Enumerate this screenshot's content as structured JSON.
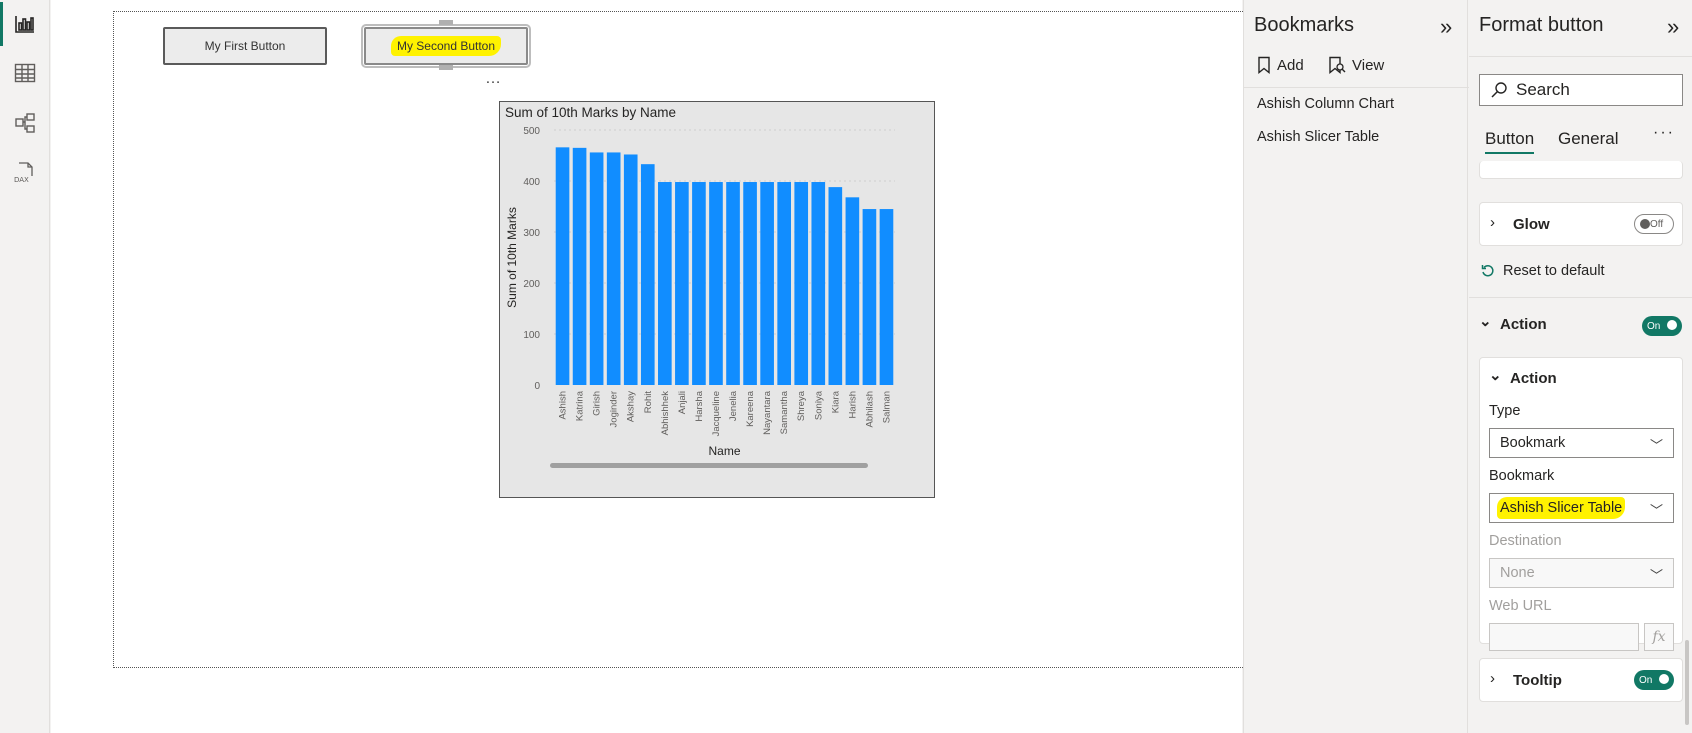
{
  "canvas": {
    "button1": "My First Button",
    "button2": "My Second Button",
    "more": "…",
    "chart_data": {
      "type": "bar",
      "title": "Sum of 10th Marks by Name",
      "xlabel": "Name",
      "ylabel": "Sum of 10th Marks",
      "ylim": [
        0,
        500
      ],
      "yticks": [
        0,
        100,
        200,
        300,
        400,
        500
      ],
      "color": "#118dff",
      "categories": [
        "Ashish",
        "Katrina",
        "Girish",
        "Joginder",
        "Akshay",
        "Rohit",
        "Abhishhek",
        "Anjali",
        "Harsha",
        "Jacqueline",
        "Jenelia",
        "Kareena",
        "Nayantara",
        "Samantha",
        "Shreya",
        "Soniya",
        "Kiara",
        "Harish",
        "Abhilash",
        "Salman"
      ],
      "values": [
        466,
        465,
        456,
        456,
        452,
        433,
        398,
        398,
        398,
        398,
        398,
        398,
        398,
        398,
        398,
        398,
        388,
        368,
        345,
        345
      ]
    }
  },
  "bookmarks": {
    "title": "Bookmarks",
    "add_label": "Add",
    "view_label": "View",
    "items": [
      "Ashish Column Chart",
      "Ashish Slicer Table"
    ]
  },
  "format": {
    "title": "Format button",
    "search_placeholder": "Search",
    "tabs": [
      "Button",
      "General"
    ],
    "more": "···",
    "glow_label": "Glow",
    "glow_toggle": "Off",
    "reset_label": "Reset to default",
    "action_section": "Action",
    "action_toggle": "On",
    "action_card_title": "Action",
    "type_label": "Type",
    "type_value": "Bookmark",
    "bookmark_label": "Bookmark",
    "bookmark_value": "Ashish Slicer Table",
    "destination_label": "Destination",
    "destination_value": "None",
    "weburl_label": "Web URL",
    "fx_label": "fx",
    "tooltip_label": "Tooltip",
    "tooltip_toggle": "On"
  },
  "highlight_color": "#fff200",
  "accent_color": "#117865"
}
